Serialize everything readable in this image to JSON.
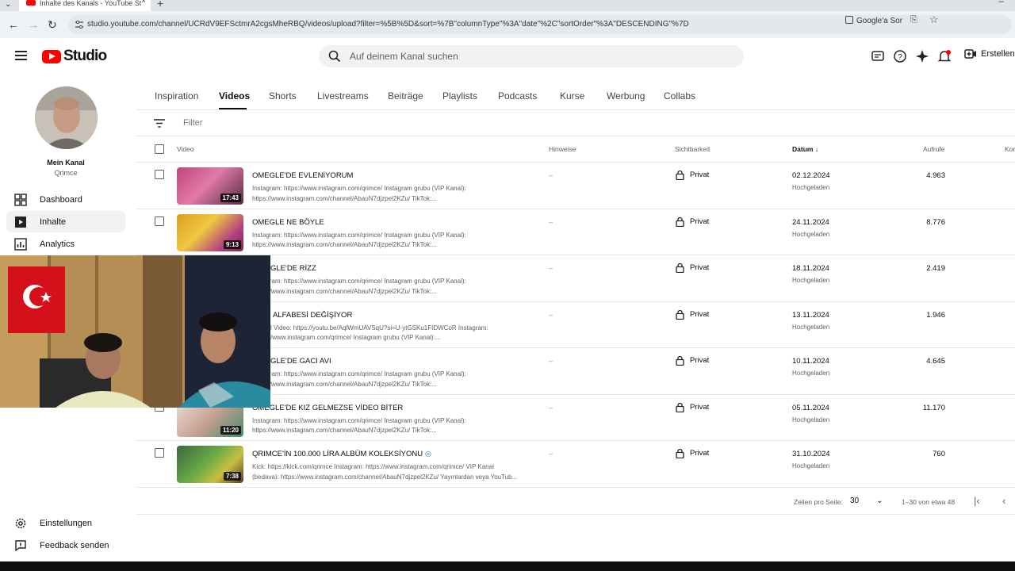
{
  "browser": {
    "tab_title": "Inhalte des Kanals - YouTube St",
    "url": "studio.youtube.com/channel/UCRdV9EFSctmrA2cgsMheRBQ/videos/upload?filter=%5B%5D&sort=%7B\"columnType\"%3A\"date\"%2C\"sortOrder\"%3A\"DESCENDING\"%7D",
    "google_lens_label": "Google'a Sor"
  },
  "header": {
    "logo_text": "Studio",
    "search_placeholder": "Auf deinem Kanal suchen",
    "create_label": "Erstellen"
  },
  "sidebar": {
    "channel_label": "Mein Kanal",
    "channel_name": "Qrimce",
    "items": [
      {
        "label": "Dashboard",
        "icon": "dashboard-icon"
      },
      {
        "label": "Inhalte",
        "icon": "content-icon",
        "active": true
      },
      {
        "label": "Analytics",
        "icon": "analytics-icon"
      }
    ],
    "bottom_items": [
      {
        "label": "Einstellungen",
        "icon": "gear-icon"
      },
      {
        "label": "Feedback senden",
        "icon": "feedback-icon"
      }
    ]
  },
  "tabs": [
    "Inspiration",
    "Videos",
    "Shorts",
    "Livestreams",
    "Beiträge",
    "Playlists",
    "Podcasts",
    "Kurse",
    "Werbung",
    "Collabs"
  ],
  "active_tab": "Videos",
  "filter_placeholder": "Filter",
  "columns": {
    "video": "Video",
    "hints": "Hinweise",
    "visibility": "Sichtbarkeit",
    "date": "Datum",
    "views": "Aufrufe",
    "comments_partial": "Kor"
  },
  "rows": [
    {
      "title": "OMEGLE'DE EVLENİYORUM",
      "duration": "17:43",
      "desc": "Instagram: https://www.instagram.com/qrimce/ Instagram grubu (VIP Kanal):\nhttps://www.instagram.com/channel/AbauN7djzpel2KZu/ TikTok:...",
      "hint": "–",
      "visibility": "Privat",
      "date": "02.12.2024",
      "status": "Hochgeladen",
      "views": "4.963"
    },
    {
      "title": "OMEGLE NE BÖYLE",
      "duration": "9:13",
      "desc": "Instagram: https://www.instagram.com/qrimce/ Instagram grubu (VIP Kanal):\nhttps://www.instagram.com/channel/AbauN7djzpel2KZu/ TikTok:...",
      "hint": "–",
      "visibility": "Privat",
      "date": "24.11.2024",
      "status": "Hochgeladen",
      "views": "8.776"
    },
    {
      "title": "GLE'DE RİZZ",
      "duration": "",
      "desc": "Instagram: https://www.instagram.com/qrimce/ Instagram grubu (VIP Kanal):\nhttps://www.instagram.com/channel/AbauN7djzpel2KZu/ TikTok:...",
      "hint": "–",
      "visibility": "Privat",
      "date": "18.11.2024",
      "status": "Hochgeladen",
      "views": "2.419"
    },
    {
      "title": "ALFABESİ DEĞİŞİYOR",
      "duration": "",
      "desc": "l Video: https://youtu.be/AqlWmUAVSqU?si=U-ytGSKu1FIDWCoR Instagram:\n/www.instagram.com/qrimce/ Instagram grubu (VIP Kanal):...",
      "hint": "–",
      "visibility": "Privat",
      "date": "13.11.2024",
      "status": "Hochgeladen",
      "views": "1.946"
    },
    {
      "title": "GLE'DE GACI AVI",
      "duration": "",
      "desc": "Instagram: https://www.instagram.com/qrimce/ Instagram grubu (VIP Kanal):\nhttps://www.instagram.com/channel/AbauN7djzpel2KZu/ TikTok:...",
      "hint": "–",
      "visibility": "Privat",
      "date": "10.11.2024",
      "status": "Hochgeladen",
      "views": "4.645"
    },
    {
      "title": "OMEGLE'DE KIZ GELMEZSE VİDEO BİTER",
      "duration": "11:20",
      "desc": "Instagram: https://www.instagram.com/qrimce/ Instagram grubu (VIP Kanal):\nhttps://www.instagram.com/channel/AbauN7djzpel2KZu/ TikTok:...",
      "hint": "–",
      "visibility": "Privat",
      "date": "05.11.2024",
      "status": "Hochgeladen",
      "views": "11.170"
    },
    {
      "title": "QRIMCE'İN 100.000 LİRA ALBÜM KOLEKSİYONU",
      "duration": "7:38",
      "desc": "Kick: https://kick.com/qrimce Instagram: https://www.instagram.com/qrimce/ VIP Kanal\n(bedava): https://www.instagram.com/channel/AbauN7djzpel2KZu/ Yayınlardan veya YouTub...",
      "hint": "–",
      "visibility": "Privat",
      "date": "31.10.2024",
      "status": "Hochgeladen",
      "views": "760"
    }
  ],
  "pager": {
    "rows_per_page_label": "Zeilen pro Seite:",
    "rows_per_page_value": "30",
    "range": "1–30 von etwa 48"
  },
  "colors": {
    "brand_red": "#ff0000",
    "text": "#0d0d0d",
    "muted": "#606060"
  }
}
